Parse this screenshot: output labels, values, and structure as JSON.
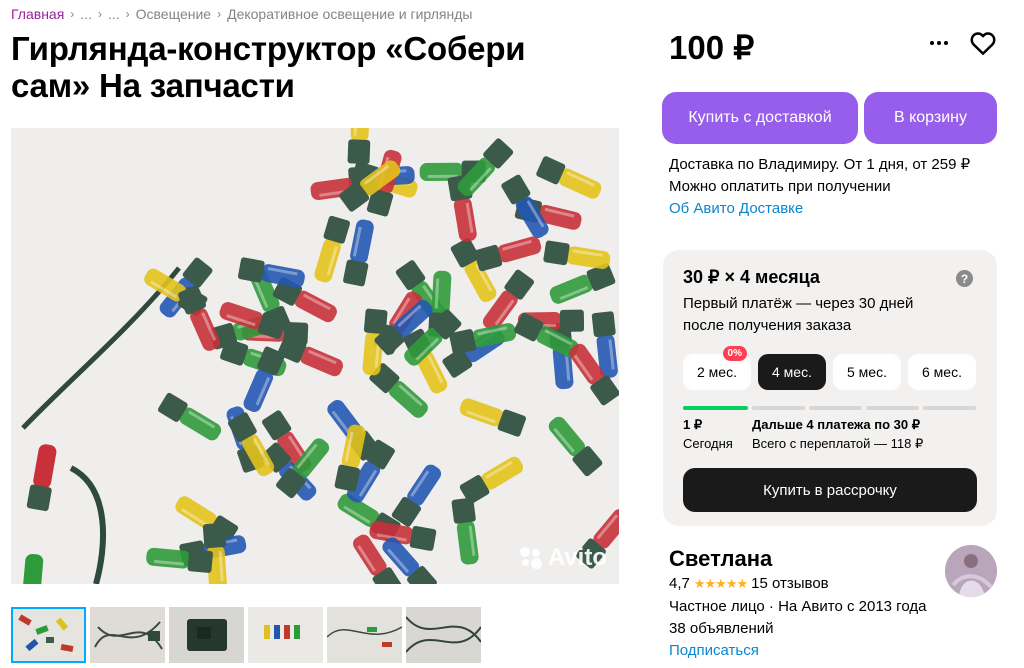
{
  "breadcrumbs": [
    "Главная",
    "...",
    "...",
    "Освещение",
    "Декоративное освещение и гирлянды"
  ],
  "title": "Гирлянда-конструктор «Собери сам» На запчасти",
  "price": "100 ₽",
  "buttons": {
    "buy_delivery": "Купить с доставкой",
    "cart": "В корзину"
  },
  "delivery": {
    "line1": "Доставка по Владимиру. От 1 дня, от 259 ₽",
    "line2": "Можно оплатить при получении",
    "link": "Об Авито Доставке"
  },
  "installment": {
    "title": "30 ₽ × 4 месяца",
    "help": "?",
    "description": "Первый платёж — через 30 дней после получения заказа",
    "terms": [
      "2 мес.",
      "4 мес.",
      "5 мес.",
      "6 мес."
    ],
    "selected_term": "4 мес.",
    "badge": "0%",
    "schedule": {
      "first_amount": "1 ₽",
      "first_label": "Сегодня",
      "rest_amount": "Дальше 4 платежа по 30 ₽",
      "rest_label": "Всего с переплатой — 118 ₽"
    },
    "button": "Купить в рассрочку"
  },
  "seller": {
    "name": "Светлана",
    "rating": "4,7",
    "stars": "★★★★★",
    "reviews": "15 отзывов",
    "type": "Частное лицо · На Авито с 2013 года",
    "listings": "38 объявлений",
    "subscribe": "Подписаться"
  },
  "photo": {
    "watermark": "Avito",
    "thumbnail_count": 6
  },
  "colors": {
    "accent_purple": "#965eeb",
    "link_blue": "#0a85d1",
    "breadcrumb_home": "#9b1f9e",
    "progress_green": "#02d15c",
    "badge_red": "#ff4053",
    "panel_bg": "#f2f1f0"
  },
  "icons": {
    "more": "more-dots-icon",
    "favorite": "heart-icon",
    "help": "question-icon",
    "star": "star-icon"
  }
}
